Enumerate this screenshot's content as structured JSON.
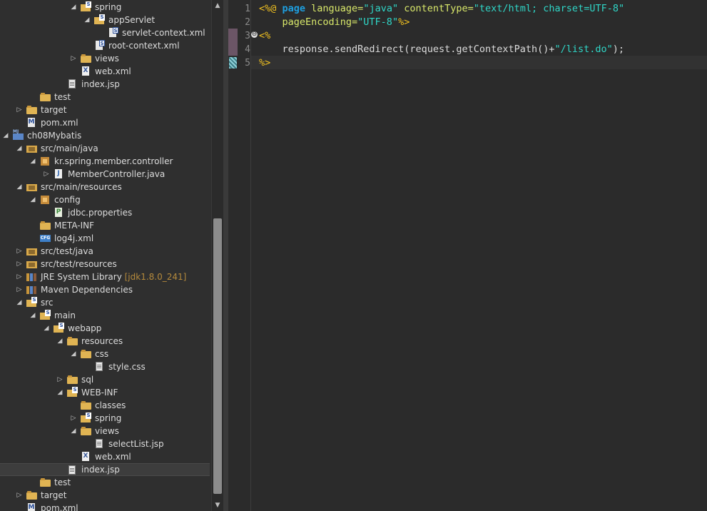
{
  "explorer": {
    "rows": [
      {
        "label": "spring",
        "icon": "spring-folder-icon",
        "expanded": true
      },
      {
        "label": "appServlet",
        "icon": "spring-folder-icon",
        "expanded": true
      },
      {
        "label": "servlet-context.xml",
        "icon": "spring-xml-file-icon"
      },
      {
        "label": "root-context.xml",
        "icon": "spring-xml-file-icon"
      },
      {
        "label": "views",
        "icon": "folder-icon",
        "expanded": false
      },
      {
        "label": "web.xml",
        "icon": "xml-file-icon"
      },
      {
        "label": "index.jsp",
        "icon": "jsp-file-icon"
      },
      {
        "label": "test",
        "icon": "folder-icon"
      },
      {
        "label": "target",
        "icon": "folder-icon",
        "expanded": false
      },
      {
        "label": "pom.xml",
        "icon": "maven-pom-icon"
      },
      {
        "label": "ch08Mybatis",
        "icon": "maven-project-icon",
        "expanded": true
      },
      {
        "label": "src/main/java",
        "icon": "source-folder-icon",
        "expanded": true
      },
      {
        "label": "kr.spring.member.controller",
        "icon": "package-icon",
        "expanded": true
      },
      {
        "label": "MemberController.java",
        "icon": "java-file-icon",
        "expanded": false
      },
      {
        "label": "src/main/resources",
        "icon": "source-folder-icon",
        "expanded": true
      },
      {
        "label": "config",
        "icon": "package-icon",
        "expanded": true
      },
      {
        "label": "jdbc.properties",
        "icon": "properties-file-icon"
      },
      {
        "label": "META-INF",
        "icon": "folder-icon"
      },
      {
        "label": "log4j.xml",
        "icon": "config-file-icon"
      },
      {
        "label": "src/test/java",
        "icon": "source-folder-icon",
        "expanded": false
      },
      {
        "label": "src/test/resources",
        "icon": "source-folder-icon",
        "expanded": false
      },
      {
        "label": "JRE System Library",
        "decoration": "[jdk1.8.0_241]",
        "icon": "library-icon",
        "expanded": false
      },
      {
        "label": "Maven Dependencies",
        "icon": "library-icon",
        "expanded": false
      },
      {
        "label": "src",
        "icon": "spring-folder-icon",
        "expanded": true
      },
      {
        "label": "main",
        "icon": "spring-folder-icon",
        "expanded": true
      },
      {
        "label": "webapp",
        "icon": "spring-folder-icon",
        "expanded": true
      },
      {
        "label": "resources",
        "icon": "folder-icon",
        "expanded": true
      },
      {
        "label": "css",
        "icon": "folder-icon",
        "expanded": true
      },
      {
        "label": "style.css",
        "icon": "css-file-icon"
      },
      {
        "label": "sql",
        "icon": "folder-icon",
        "expanded": false
      },
      {
        "label": "WEB-INF",
        "icon": "spring-folder-icon",
        "expanded": true
      },
      {
        "label": "classes",
        "icon": "folder-icon"
      },
      {
        "label": "spring",
        "icon": "spring-folder-icon",
        "expanded": false
      },
      {
        "label": "views",
        "icon": "folder-icon",
        "expanded": true
      },
      {
        "label": "selectList.jsp",
        "icon": "jsp-file-icon"
      },
      {
        "label": "web.xml",
        "icon": "xml-file-icon"
      },
      {
        "label": "index.jsp",
        "icon": "jsp-file-icon",
        "selected": true
      },
      {
        "label": "test",
        "icon": "folder-icon"
      },
      {
        "label": "target",
        "icon": "folder-icon",
        "expanded": false
      },
      {
        "label": "pom.xml",
        "icon": "maven-pom-icon"
      }
    ]
  },
  "editor": {
    "line_numbers": [
      "1",
      "2",
      "3",
      "4",
      "5"
    ],
    "lines": [
      [
        {
          "t": "<%@ ",
          "c": "tag"
        },
        {
          "t": "page ",
          "c": "kw"
        },
        {
          "t": "language=",
          "c": "attr"
        },
        {
          "t": "\"java\" ",
          "c": "str"
        },
        {
          "t": "contentType=",
          "c": "attr"
        },
        {
          "t": "\"text/html; charset=UTF-8\"",
          "c": "str"
        }
      ],
      [
        {
          "t": "    pageEncoding=",
          "c": "attr"
        },
        {
          "t": "\"UTF-8\"",
          "c": "str"
        },
        {
          "t": "%>",
          "c": "tag"
        }
      ],
      [
        {
          "t": "<%",
          "c": "tag"
        }
      ],
      [
        {
          "t": "    response.sendRedirect(request.getContextPath()+",
          "c": "plain"
        },
        {
          "t": "\"/list.do\"",
          "c": "str"
        },
        {
          "t": ");",
          "c": "plain"
        }
      ],
      [
        {
          "t": "%>",
          "c": "tag"
        }
      ]
    ],
    "fold_marker": "⊖"
  },
  "colors": {
    "tag": "#f0c020",
    "keyword": "#1e9fe0",
    "attribute": "#d9e86a",
    "string": "#2fd6c7"
  }
}
